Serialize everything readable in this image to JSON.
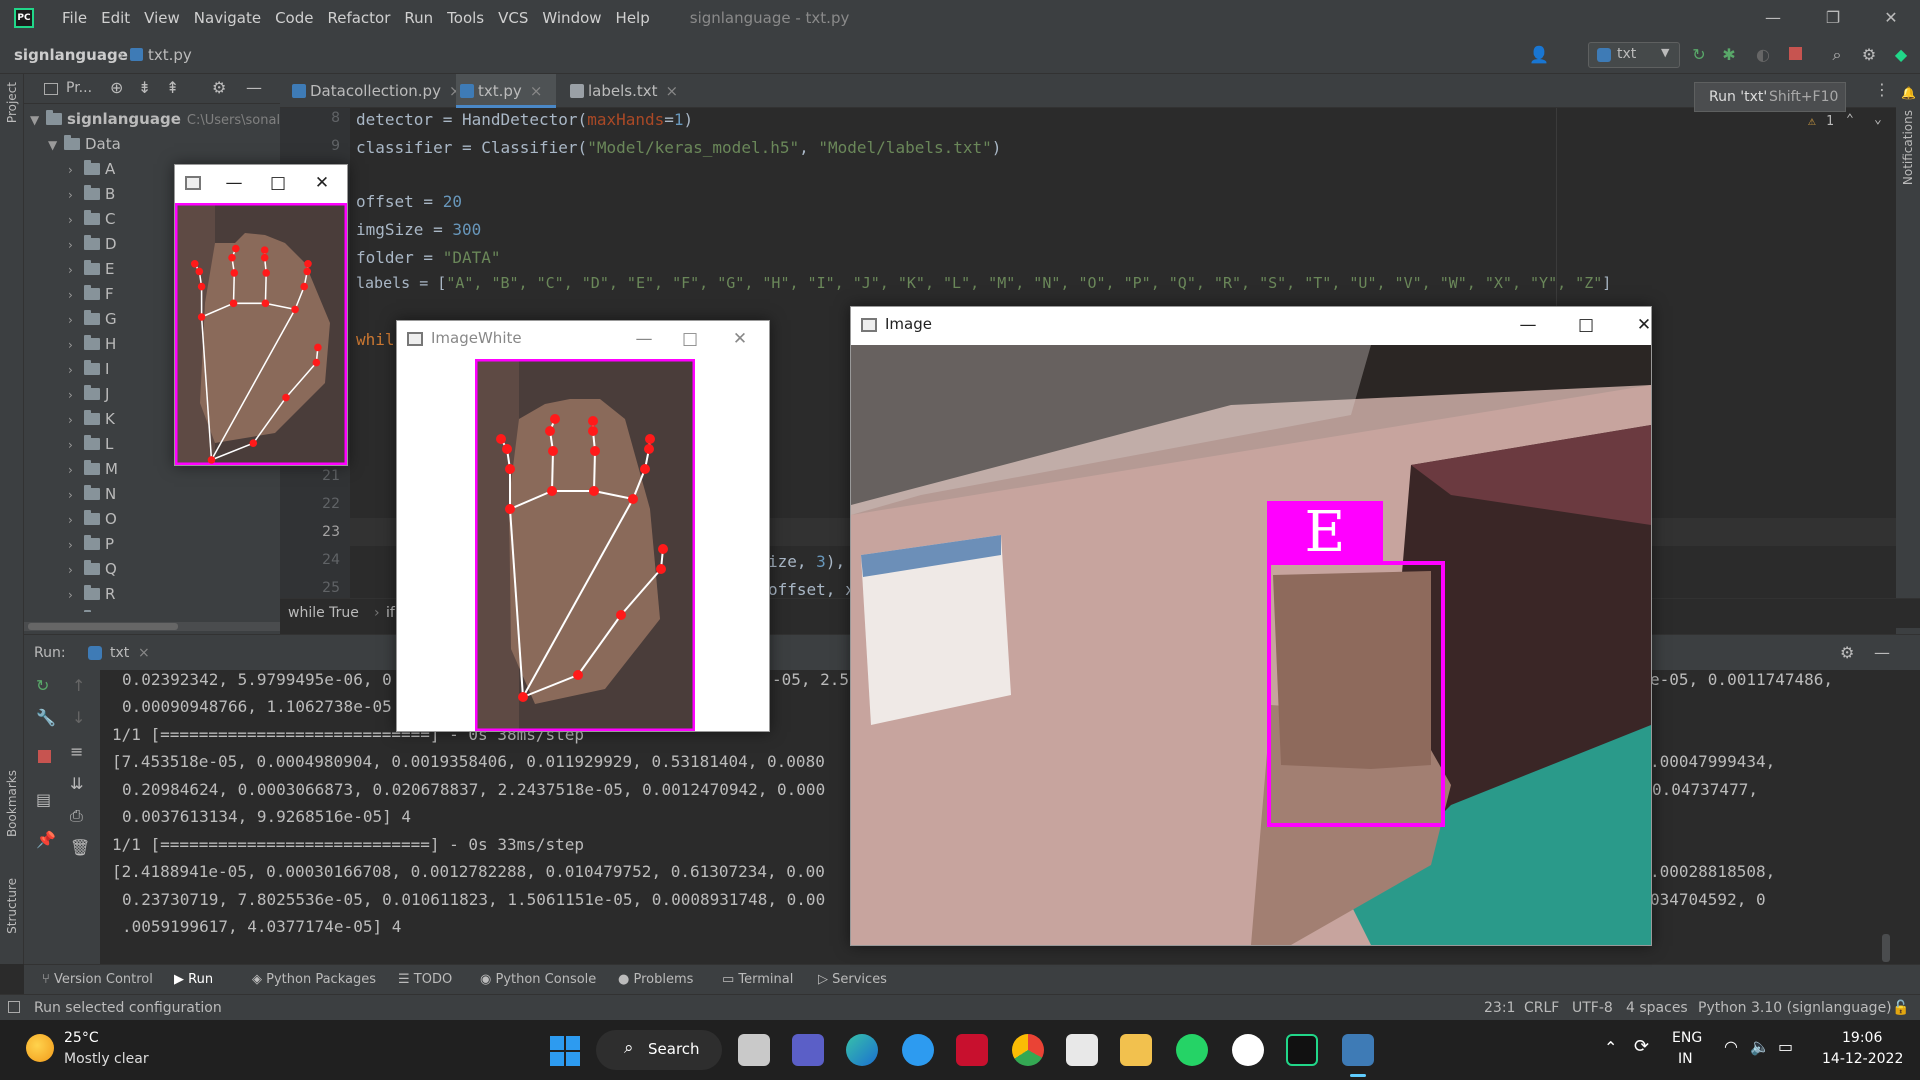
{
  "menubar": {
    "items": [
      "File",
      "Edit",
      "View",
      "Navigate",
      "Code",
      "Refactor",
      "Run",
      "Tools",
      "VCS",
      "Window",
      "Help"
    ],
    "title": "signlanguage - txt.py"
  },
  "navbar": {
    "project": "signlanguage",
    "file": "txt.py",
    "run_config": "txt",
    "tooltip_label": "Run 'txt'",
    "tooltip_shortcut": "Shift+F10"
  },
  "project_panel": {
    "title": "Pr...",
    "root": "signlanguage",
    "root_path": "C:\\Users\\sonal",
    "data_folder": "Data",
    "folders": [
      "A",
      "B",
      "C",
      "D",
      "E",
      "F",
      "G",
      "H",
      "I",
      "J",
      "K",
      "L",
      "M",
      "N",
      "O",
      "P",
      "Q",
      "R",
      "S"
    ]
  },
  "left_strip": {
    "project": "Project",
    "bookmarks": "Bookmarks",
    "structure": "Structure"
  },
  "right_strip": {
    "notifications": "Notifications"
  },
  "editor": {
    "tabs": [
      "Datacollection.py",
      "txt.py",
      "labels.txt"
    ],
    "active_tab": "txt.py",
    "warnings": "1",
    "line_numbers": [
      "8",
      "9",
      "21",
      "22",
      "23",
      "24",
      "25"
    ],
    "lines": {
      "l8a": "detector = HandDetector(",
      "l8b": "maxHands",
      "l8c": "=",
      "l8d": "1",
      "l8e": ")",
      "l9a": "classifier = Classifier(",
      "l9b": "\"Model/keras_model.h5\"",
      "l9c": ", ",
      "l9d": "\"Model/labels.txt\"",
      "l9e": ")",
      "l11a": "offset = ",
      "l11b": "20",
      "l12a": "imgSize = ",
      "l12b": "300",
      "l13a": "folder = ",
      "l13b": "\"DATA\"",
      "l14a": "labels = [",
      "l14b": "\"A\", \"B\", \"C\", \"D\", \"E\", \"F\", \"G\", \"H\", \"I\", \"J\", \"K\", \"L\", \"M\", \"N\", \"O\", \"P\", \"Q\", \"R\", \"S\", \"T\", \"U\", \"V\", \"W\", \"X\", \"Y\", \"Z\"",
      "l14c": "]",
      "l16": "whil",
      "l24a": "ize, ",
      "l24b": "3",
      "l24c": "),",
      "l25": "offset, x"
    },
    "breadcrumb": [
      "while True",
      "if"
    ]
  },
  "run_panel": {
    "label": "Run:",
    "config": "txt",
    "lines": [
      "0.02392342, 5.9799495e-06, 0",
      "0.00090948766, 1.1062738e-05",
      "1/1 [============================] - 0s 38ms/step",
      "[7.453518e-05, 0.0004980904, 0.0019358406, 0.011929929, 0.53181404, 0.0080",
      "0.20984624, 0.0003066873, 0.020678837, 2.2437518e-05, 0.0012470942, 0.000",
      "0.0037613134, 9.9268516e-05] 4",
      "1/1 [============================] - 0s 33ms/step",
      "[2.4188941e-05, 0.00030166708, 0.0012782288, 0.010479752, 0.61307234, 0.00",
      "0.23730719, 7.8025536e-05, 0.010611823, 1.5061151e-05, 0.0008931748, 0.00",
      ".0059199617, 4.0377174e-05] 4"
    ],
    "mid": [
      "-05, 2.5"
    ],
    "right": [
      "e-05, 0.0011747486,",
      ".00047999434,",
      "0.04737477,",
      ".00028818508,",
      "034704592, 0"
    ]
  },
  "tool_tabs": [
    "Version Control",
    "Run",
    "Python Packages",
    "TODO",
    "Python Console",
    "Problems",
    "Terminal",
    "Services"
  ],
  "statusbar": {
    "message": "Run selected configuration",
    "position": "23:1",
    "line_sep": "CRLF",
    "encoding": "UTF-8",
    "indent": "4 spaces",
    "interpreter": "Python 3.10 (signlanguage)"
  },
  "windows": {
    "crop_title": "",
    "white_title": "ImageWhite",
    "image_title": "Image",
    "predicted_letter": "E"
  },
  "taskbar": {
    "temp": "25°C",
    "weather": "Mostly clear",
    "search": "Search",
    "lang1": "ENG",
    "lang2": "IN",
    "time": "19:06",
    "date": "14-12-2022"
  },
  "colors": {
    "accent": "#ff00ff",
    "ide_bg": "#2b2b2b",
    "panel": "#3c3f41"
  }
}
